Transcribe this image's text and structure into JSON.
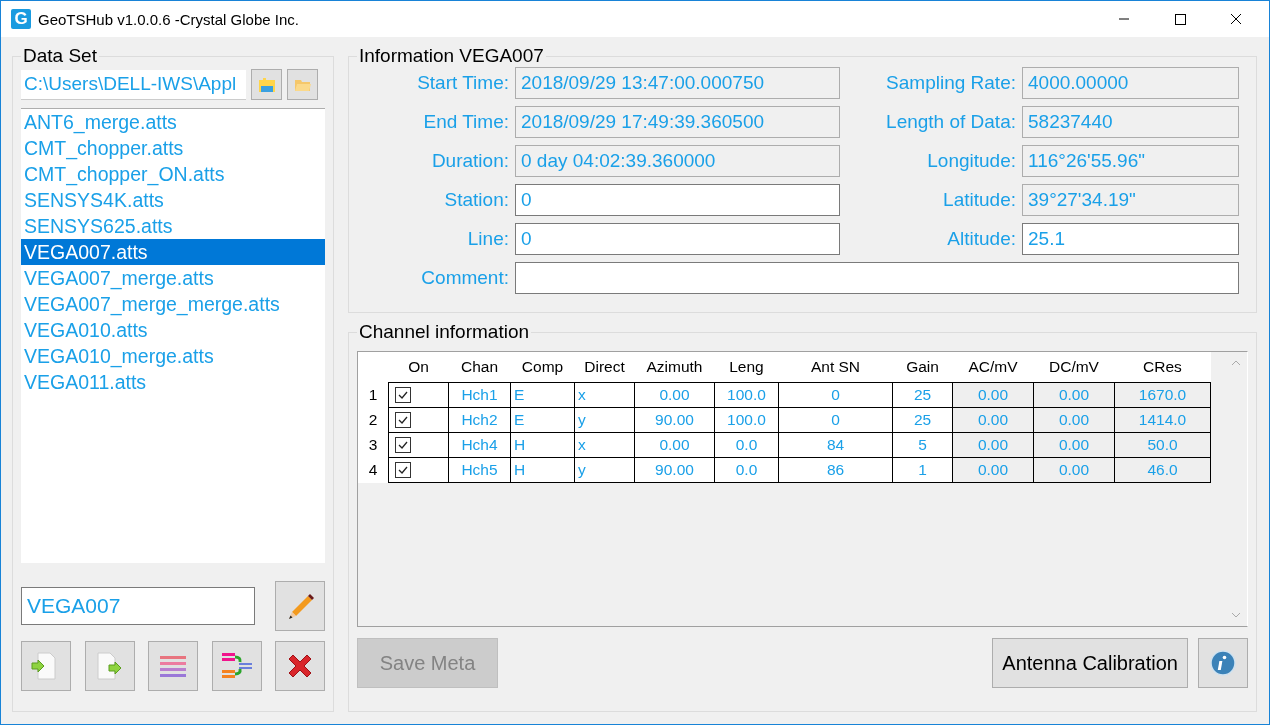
{
  "window": {
    "icon_letter": "G",
    "title": "GeoTSHub v1.0.0.6 -Crystal Globe Inc."
  },
  "data_set": {
    "title": "Data Set",
    "path": "C:\\Users\\DELL-IWS\\Appl",
    "files": [
      {
        "name": "ANT6_merge.atts",
        "selected": false
      },
      {
        "name": "CMT_chopper.atts",
        "selected": false
      },
      {
        "name": "CMT_chopper_ON.atts",
        "selected": false
      },
      {
        "name": "SENSYS4K.atts",
        "selected": false
      },
      {
        "name": "SENSYS625.atts",
        "selected": false
      },
      {
        "name": "VEGA007.atts",
        "selected": true
      },
      {
        "name": "VEGA007_merge.atts",
        "selected": false
      },
      {
        "name": "VEGA007_merge_merge.atts",
        "selected": false
      },
      {
        "name": "VEGA010.atts",
        "selected": false
      },
      {
        "name": "VEGA010_merge.atts",
        "selected": false
      },
      {
        "name": "VEGA011.atts",
        "selected": false
      }
    ],
    "name_value": "VEGA007"
  },
  "information": {
    "title": "Information VEGA007",
    "rows": [
      [
        {
          "label": "Start Time:",
          "value": "2018/09/29 13:47:00.000750",
          "editable": false
        },
        {
          "label": "Sampling Rate:",
          "value": "4000.00000",
          "editable": false
        }
      ],
      [
        {
          "label": "End Time:",
          "value": "2018/09/29 17:49:39.360500",
          "editable": false
        },
        {
          "label": "Length of Data:",
          "value": "58237440",
          "editable": false
        }
      ],
      [
        {
          "label": "Duration:",
          "value": "0 day 04:02:39.360000",
          "editable": false
        },
        {
          "label": "Longitude:",
          "value": "116°26'55.96\"",
          "editable": false
        }
      ],
      [
        {
          "label": "Station:",
          "value": "0",
          "editable": true
        },
        {
          "label": "Latitude:",
          "value": "39°27'34.19\"",
          "editable": false
        }
      ],
      [
        {
          "label": "Line:",
          "value": "0",
          "editable": true
        },
        {
          "label": "Altitude:",
          "value": "25.1",
          "editable": true
        }
      ],
      [
        {
          "label": "Comment:",
          "editable": true
        }
      ]
    ]
  },
  "channels": {
    "title": "Channel information",
    "columns": [
      "On",
      "Chan",
      "Comp",
      "Direct",
      "Azimuth",
      "Leng",
      "Ant SN",
      "Gain",
      "AC/mV",
      "DC/mV",
      "CRes"
    ],
    "rows": [
      {
        "number": "1",
        "cells": [
          {
            "kind": "checkbox",
            "checked": true
          },
          {
            "kind": "text",
            "text": "Hch1",
            "readonly": false
          },
          {
            "kind": "text",
            "text": "E",
            "readonly": false
          },
          {
            "kind": "text",
            "text": "x",
            "readonly": false
          },
          {
            "kind": "text",
            "text": "0.00",
            "readonly": false
          },
          {
            "kind": "text",
            "text": "100.0",
            "readonly": false
          },
          {
            "kind": "text",
            "text": "0",
            "readonly": false
          },
          {
            "kind": "text",
            "text": "25",
            "readonly": false
          },
          {
            "kind": "text",
            "text": "0.00",
            "readonly": true
          },
          {
            "kind": "text",
            "text": "0.00",
            "readonly": true
          },
          {
            "kind": "text",
            "text": "1670.0",
            "readonly": true
          }
        ]
      },
      {
        "number": "2",
        "cells": [
          {
            "kind": "checkbox",
            "checked": true
          },
          {
            "kind": "text",
            "text": "Hch2",
            "readonly": false
          },
          {
            "kind": "text",
            "text": "E",
            "readonly": false
          },
          {
            "kind": "text",
            "text": "y",
            "readonly": false
          },
          {
            "kind": "text",
            "text": "90.00",
            "readonly": false
          },
          {
            "kind": "text",
            "text": "100.0",
            "readonly": false
          },
          {
            "kind": "text",
            "text": "0",
            "readonly": false
          },
          {
            "kind": "text",
            "text": "25",
            "readonly": false
          },
          {
            "kind": "text",
            "text": "0.00",
            "readonly": true
          },
          {
            "kind": "text",
            "text": "0.00",
            "readonly": true
          },
          {
            "kind": "text",
            "text": "1414.0",
            "readonly": true
          }
        ]
      },
      {
        "number": "3",
        "cells": [
          {
            "kind": "checkbox",
            "checked": true
          },
          {
            "kind": "text",
            "text": "Hch4",
            "readonly": false
          },
          {
            "kind": "text",
            "text": "H",
            "readonly": false
          },
          {
            "kind": "text",
            "text": "x",
            "readonly": false
          },
          {
            "kind": "text",
            "text": "0.00",
            "readonly": false
          },
          {
            "kind": "text",
            "text": "0.0",
            "readonly": false
          },
          {
            "kind": "text",
            "text": "84",
            "readonly": false
          },
          {
            "kind": "text",
            "text": "5",
            "readonly": false
          },
          {
            "kind": "text",
            "text": "0.00",
            "readonly": true
          },
          {
            "kind": "text",
            "text": "0.00",
            "readonly": true
          },
          {
            "kind": "text",
            "text": "50.0",
            "readonly": true
          }
        ]
      },
      {
        "number": "4",
        "cells": [
          {
            "kind": "checkbox",
            "checked": true
          },
          {
            "kind": "text",
            "text": "Hch5",
            "readonly": false
          },
          {
            "kind": "text",
            "text": "H",
            "readonly": false
          },
          {
            "kind": "text",
            "text": "y",
            "readonly": false
          },
          {
            "kind": "text",
            "text": "90.00",
            "readonly": false
          },
          {
            "kind": "text",
            "text": "0.0",
            "readonly": false
          },
          {
            "kind": "text",
            "text": "86",
            "readonly": false
          },
          {
            "kind": "text",
            "text": "1",
            "readonly": false
          },
          {
            "kind": "text",
            "text": "0.00",
            "readonly": true
          },
          {
            "kind": "text",
            "text": "0.00",
            "readonly": true
          },
          {
            "kind": "text",
            "text": "46.0",
            "readonly": true
          }
        ]
      }
    ]
  },
  "buttons": [
    {
      "label": "Save Meta",
      "disabled": true
    },
    {
      "label": "Antenna Calibration",
      "disabled": false
    }
  ]
}
